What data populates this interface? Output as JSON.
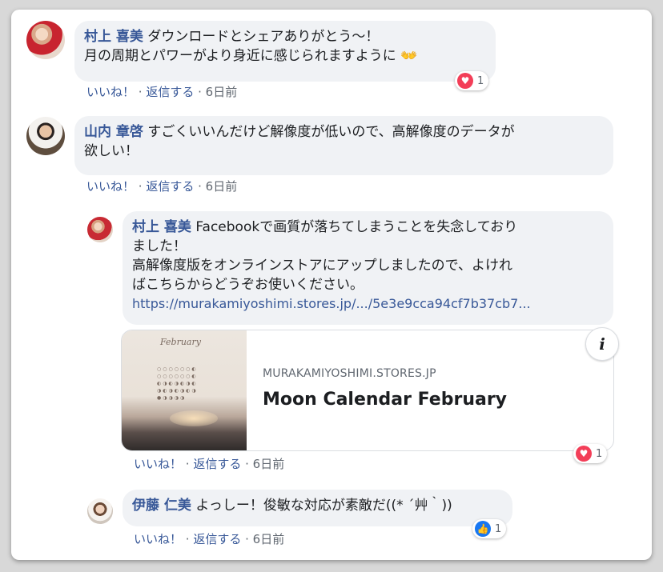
{
  "comments": [
    {
      "author": "村上 喜美",
      "text_line1": "ダウンロードとシェアありがとう〜！",
      "text_line2": "月の周期とパワーがより身近に感じられますように",
      "emoji": "👐",
      "reaction": {
        "type": "love",
        "icon": "heart-icon",
        "count": "1"
      },
      "actions": {
        "like": "いいね！",
        "reply": "返信する",
        "time": "6日前"
      }
    },
    {
      "author": "山内 章啓",
      "text_line1": "すごくいいんだけど解像度が低いので、高解像度のデータが",
      "text_line2": "欲しい！",
      "actions": {
        "like": "いいね！",
        "reply": "返信する",
        "time": "6日前"
      }
    }
  ],
  "replies": [
    {
      "author": "村上 喜美",
      "text_line1": "Facebookで画質が落ちてしまうことを失念してお",
      "text_line1b": "り",
      "text_line2": "ました！",
      "text_line3": "高解像度版をオンラインストアにアップしましたので、よけれ",
      "text_line4": "ばこちらからどうぞお使いください。",
      "link": "https://murakamiyoshimi.stores.jp/.../5e3e9cca94cf7b37cb7...",
      "preview": {
        "domain": "MURAKAMIYOSHIMI.STORES.JP",
        "title": "Moon Calendar February",
        "thumb_title": "February",
        "info_icon": "i"
      },
      "reaction": {
        "type": "love",
        "icon": "heart-icon",
        "count": "1"
      },
      "actions": {
        "like": "いいね！",
        "reply": "返信する",
        "time": "6日前"
      }
    },
    {
      "author": "伊藤 仁美",
      "text": "よっしー！俊敏な対応が素敵だ((* ´艸｀))",
      "reaction": {
        "type": "like",
        "icon": "thumbs-up-icon",
        "count": "1"
      },
      "actions": {
        "like": "いいね！",
        "reply": "返信する",
        "time": "6日前"
      }
    }
  ],
  "ui": {
    "sep": " · "
  },
  "colors": {
    "link": "#385898",
    "bubble": "#f0f2f5",
    "love": "#f33e58",
    "like": "#1877f2"
  }
}
